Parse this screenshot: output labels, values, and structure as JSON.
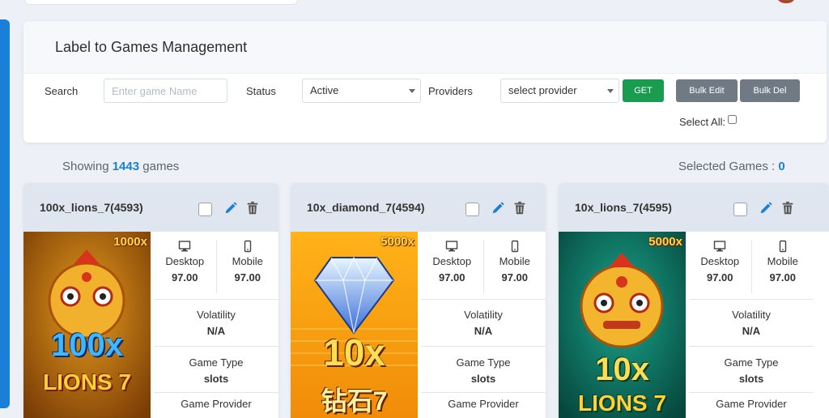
{
  "page": {
    "title": "Label to Games Management"
  },
  "filters": {
    "search_label": "Search",
    "search_placeholder": "Enter game Name",
    "status_label": "Status",
    "status_value": "Active",
    "providers_label": "Providers",
    "provider_value": "select provider",
    "get_label": "GET",
    "bulk_edit_label": "Bulk Edit",
    "bulk_del_label": "Bulk Del",
    "select_all_label": "Select All:"
  },
  "summary": {
    "showing_prefix": "Showing",
    "count": "1443",
    "showing_suffix": "games",
    "selected_label": "Selected Games :",
    "selected_count": "0"
  },
  "colors": {
    "accent": "#1a7fd6",
    "get_button": "#1a9c4f",
    "gray_button": "#6f7a85",
    "card_header": "#dfe6ef"
  },
  "icons": {
    "edit": "pencil-icon",
    "delete": "trash-icon",
    "desktop": "desktop-icon",
    "mobile": "mobile-icon"
  },
  "cards": [
    {
      "title": "100x_lions_7(4593)",
      "multiplier": "1000x",
      "art_line1": "100x",
      "art_line2": "LIONS 7",
      "desktop_label": "Desktop",
      "desktop_value": "97.00",
      "mobile_label": "Mobile",
      "mobile_value": "97.00",
      "volatility_label": "Volatility",
      "volatility_value": "N/A",
      "game_type_label": "Game Type",
      "game_type_value": "slots",
      "provider_label": "Game Provider"
    },
    {
      "title": "10x_diamond_7(4594)",
      "multiplier": "5000x",
      "art_line1": "10x",
      "art_line2": "钻石7",
      "desktop_label": "Desktop",
      "desktop_value": "97.00",
      "mobile_label": "Mobile",
      "mobile_value": "97.00",
      "volatility_label": "Volatility",
      "volatility_value": "N/A",
      "game_type_label": "Game Type",
      "game_type_value": "slots",
      "provider_label": "Game Provider"
    },
    {
      "title": "10x_lions_7(4595)",
      "multiplier": "5000x",
      "art_line1": "10x",
      "art_line2": "LIONS 7",
      "desktop_label": "Desktop",
      "desktop_value": "97.00",
      "mobile_label": "Mobile",
      "mobile_value": "97.00",
      "volatility_label": "Volatility",
      "volatility_value": "N/A",
      "game_type_label": "Game Type",
      "game_type_value": "slots",
      "provider_label": "Game Provider"
    }
  ]
}
